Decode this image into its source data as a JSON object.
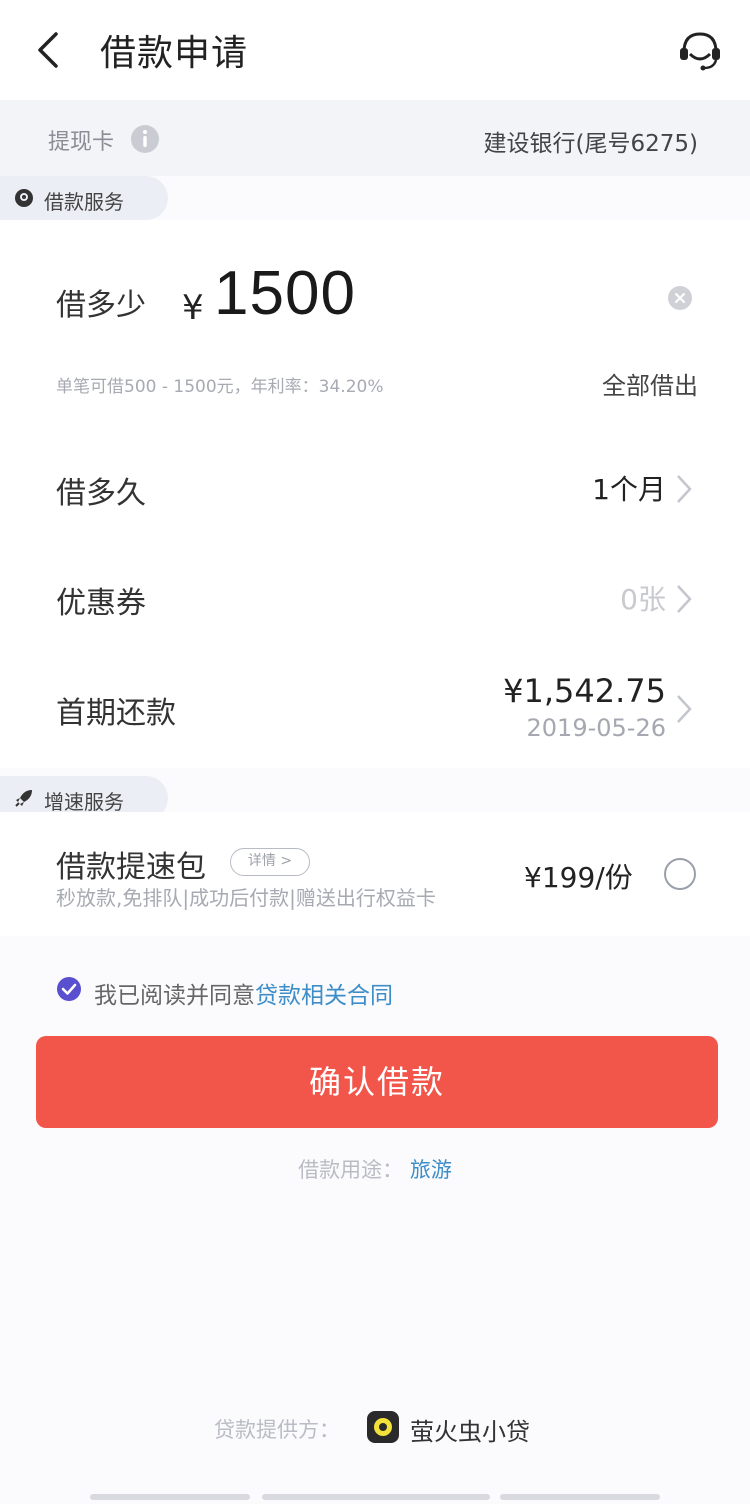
{
  "header": {
    "title": "借款申请",
    "back_icon": "back-arrow-icon",
    "service_icon": "customer-service-icon"
  },
  "card": {
    "label": "提现卡",
    "value": "建设银行(尾号6275)"
  },
  "loan_section": {
    "tag": "借款服务"
  },
  "amount": {
    "label": "借多少",
    "currency": "¥",
    "value": "1500",
    "hint": "单笔可借500 - 1500元，年利率：34.20%",
    "borrow_all": "全部借出"
  },
  "term": {
    "label": "借多久",
    "value": "1个月"
  },
  "coupon": {
    "label": "优惠券",
    "value": "0张"
  },
  "first_repayment": {
    "label": "首期还款",
    "amount": "¥1,542.75",
    "date": "2019-05-26"
  },
  "boost_section": {
    "tag": "增速服务"
  },
  "boost": {
    "title": "借款提速包",
    "detail": "详情 >",
    "desc": "秒放款,免排队|成功后付款|赠送出行权益卡",
    "price": "¥199/份",
    "selected": false
  },
  "agreement": {
    "text": "我已阅读并同意",
    "link": "贷款相关合同",
    "checked": true
  },
  "confirm": {
    "label": "确认借款"
  },
  "purpose": {
    "label": "借款用途：",
    "value": "旅游"
  },
  "provider": {
    "label": "贷款提供方：",
    "name": "萤火虫小贷"
  },
  "colors": {
    "primary_button": "#f2564b",
    "link": "#3c8dc8",
    "check": "#5a4fcf"
  }
}
